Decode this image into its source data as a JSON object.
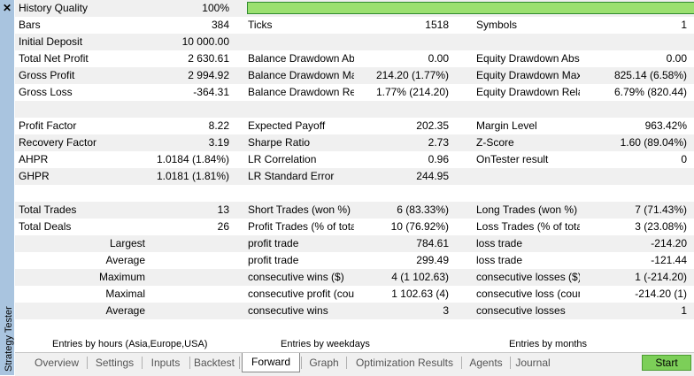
{
  "sidebar": {
    "title": "Strategy Tester",
    "close_label": "✕"
  },
  "rows": [
    {
      "cells": [
        {
          "text": "History Quality",
          "type": "label"
        },
        {
          "text": "100%",
          "type": "value"
        },
        {
          "type": "bar"
        }
      ]
    },
    {
      "cells": [
        {
          "text": "Bars",
          "type": "label"
        },
        {
          "text": "384",
          "type": "value"
        },
        {
          "text": "Ticks",
          "type": "label"
        },
        {
          "text": "1518",
          "type": "value"
        },
        {
          "text": "Symbols",
          "type": "label"
        },
        {
          "text": "1",
          "type": "value"
        }
      ]
    },
    {
      "cells": [
        {
          "text": "Initial Deposit",
          "type": "label"
        },
        {
          "text": "10 000.00",
          "type": "value"
        },
        {},
        {},
        {},
        {}
      ]
    },
    {
      "cells": [
        {
          "text": "Total Net Profit",
          "type": "label"
        },
        {
          "text": "2 630.61",
          "type": "value"
        },
        {
          "text": "Balance Drawdown Abso...",
          "type": "label"
        },
        {
          "text": "0.00",
          "type": "value"
        },
        {
          "text": "Equity Drawdown Absol...",
          "type": "label"
        },
        {
          "text": "0.00",
          "type": "value"
        }
      ]
    },
    {
      "cells": [
        {
          "text": "Gross Profit",
          "type": "label"
        },
        {
          "text": "2 994.92",
          "type": "value"
        },
        {
          "text": "Balance Drawdown Maxi...",
          "type": "label"
        },
        {
          "text": "214.20 (1.77%)",
          "type": "value"
        },
        {
          "text": "Equity Drawdown Maximal",
          "type": "label"
        },
        {
          "text": "825.14 (6.58%)",
          "type": "value"
        }
      ]
    },
    {
      "cells": [
        {
          "text": "Gross Loss",
          "type": "label"
        },
        {
          "text": "-364.31",
          "type": "value"
        },
        {
          "text": "Balance Drawdown Relat...",
          "type": "label"
        },
        {
          "text": "1.77% (214.20)",
          "type": "value"
        },
        {
          "text": "Equity Drawdown Relative",
          "type": "label"
        },
        {
          "text": "6.79% (820.44)",
          "type": "value"
        }
      ]
    },
    {
      "cells": [
        {},
        {},
        {},
        {},
        {},
        {}
      ]
    },
    {
      "cells": [
        {
          "text": "Profit Factor",
          "type": "label"
        },
        {
          "text": "8.22",
          "type": "value"
        },
        {
          "text": "Expected Payoff",
          "type": "label"
        },
        {
          "text": "202.35",
          "type": "value"
        },
        {
          "text": "Margin Level",
          "type": "label"
        },
        {
          "text": "963.42%",
          "type": "value"
        }
      ]
    },
    {
      "cells": [
        {
          "text": "Recovery Factor",
          "type": "label"
        },
        {
          "text": "3.19",
          "type": "value"
        },
        {
          "text": "Sharpe Ratio",
          "type": "label"
        },
        {
          "text": "2.73",
          "type": "value"
        },
        {
          "text": "Z-Score",
          "type": "label"
        },
        {
          "text": "1.60 (89.04%)",
          "type": "value"
        }
      ]
    },
    {
      "cells": [
        {
          "text": "AHPR",
          "type": "label"
        },
        {
          "text": "1.0184 (1.84%)",
          "type": "value"
        },
        {
          "text": "LR Correlation",
          "type": "label"
        },
        {
          "text": "0.96",
          "type": "value"
        },
        {
          "text": "OnTester result",
          "type": "label"
        },
        {
          "text": "0",
          "type": "value"
        }
      ]
    },
    {
      "cells": [
        {
          "text": "GHPR",
          "type": "label"
        },
        {
          "text": "1.0181 (1.81%)",
          "type": "value"
        },
        {
          "text": "LR Standard Error",
          "type": "label"
        },
        {
          "text": "244.95",
          "type": "value"
        },
        {},
        {}
      ]
    },
    {
      "cells": [
        {},
        {},
        {},
        {},
        {},
        {}
      ]
    },
    {
      "cells": [
        {
          "text": "Total Trades",
          "type": "label"
        },
        {
          "text": "13",
          "type": "value"
        },
        {
          "text": "Short Trades (won %)",
          "type": "label"
        },
        {
          "text": "6 (83.33%)",
          "type": "value"
        },
        {
          "text": "Long Trades (won %)",
          "type": "label"
        },
        {
          "text": "7 (71.43%)",
          "type": "value"
        }
      ]
    },
    {
      "cells": [
        {
          "text": "Total Deals",
          "type": "label"
        },
        {
          "text": "26",
          "type": "value"
        },
        {
          "text": "Profit Trades (% of total)",
          "type": "label"
        },
        {
          "text": "10 (76.92%)",
          "type": "value"
        },
        {
          "text": "Loss Trades (% of total)",
          "type": "label"
        },
        {
          "text": "3 (23.08%)",
          "type": "value"
        }
      ]
    },
    {
      "cells": [
        {
          "text": "Largest",
          "type": "value"
        },
        {},
        {
          "text": "profit trade",
          "type": "label"
        },
        {
          "text": "784.61",
          "type": "value"
        },
        {
          "text": "loss trade",
          "type": "label"
        },
        {
          "text": "-214.20",
          "type": "value"
        }
      ]
    },
    {
      "cells": [
        {
          "text": "Average",
          "type": "value"
        },
        {},
        {
          "text": "profit trade",
          "type": "label"
        },
        {
          "text": "299.49",
          "type": "value"
        },
        {
          "text": "loss trade",
          "type": "label"
        },
        {
          "text": "-121.44",
          "type": "value"
        }
      ]
    },
    {
      "cells": [
        {
          "text": "Maximum",
          "type": "value"
        },
        {},
        {
          "text": "consecutive wins ($)",
          "type": "label"
        },
        {
          "text": "4 (1 102.63)",
          "type": "value"
        },
        {
          "text": "consecutive losses ($)",
          "type": "label"
        },
        {
          "text": "1 (-214.20)",
          "type": "value"
        }
      ]
    },
    {
      "cells": [
        {
          "text": "Maximal",
          "type": "value"
        },
        {},
        {
          "text": "consecutive profit (count)",
          "type": "label"
        },
        {
          "text": "1 102.63 (4)",
          "type": "value"
        },
        {
          "text": "consecutive loss (count)",
          "type": "label"
        },
        {
          "text": "-214.20 (1)",
          "type": "value"
        }
      ]
    },
    {
      "cells": [
        {
          "text": "Average",
          "type": "value"
        },
        {},
        {
          "text": "consecutive wins",
          "type": "label"
        },
        {
          "text": "3",
          "type": "value"
        },
        {
          "text": "consecutive losses",
          "type": "label"
        },
        {
          "text": "1",
          "type": "value"
        }
      ]
    }
  ],
  "subtabs": [
    "Entries by hours (Asia,Europe,USA)",
    "Entries by weekdays",
    "Entries by months"
  ],
  "tabs": [
    "Overview",
    "Settings",
    "Inputs",
    "Backtest",
    "Forward",
    "Graph",
    "Optimization Results",
    "Agents",
    "Journal"
  ],
  "active_tab": "Forward",
  "start_label": "Start",
  "colors": {
    "quality_bar": "#9be070",
    "start_button": "#7ccf58",
    "sidebar": "#a9c4df"
  }
}
